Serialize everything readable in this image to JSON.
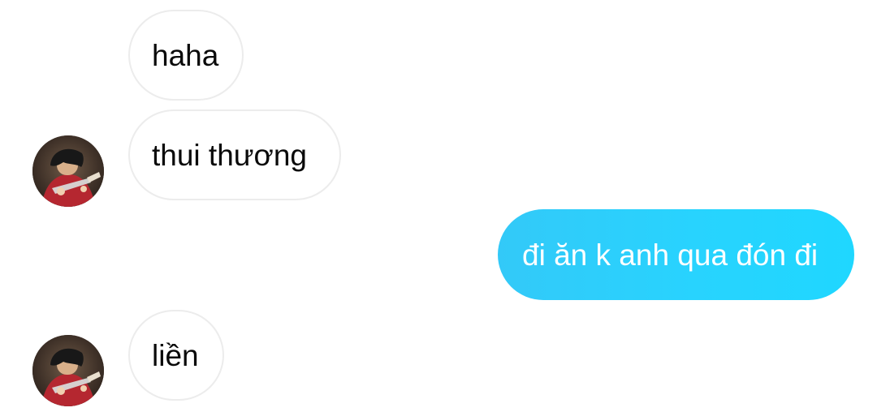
{
  "messages": {
    "received_1": "haha",
    "received_2": "thui thương",
    "sent_1": "đi ăn k anh qua đón đi",
    "received_3": "liền"
  },
  "colors": {
    "sent_bubble_start": "#33c9f8",
    "sent_bubble_end": "#1fd7ff",
    "received_border": "#ececec",
    "text_dark": "#0a0a0a",
    "text_light": "#ffffff"
  },
  "icons": {
    "avatar": "profile-avatar-icon"
  }
}
